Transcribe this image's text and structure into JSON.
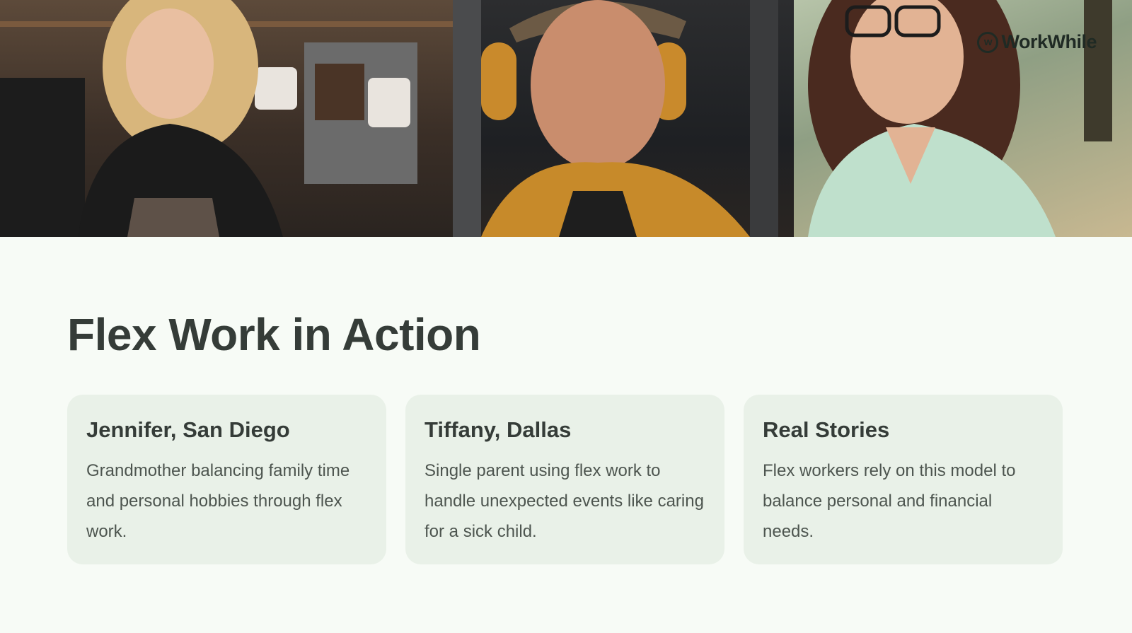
{
  "brand": {
    "name": "WorkWhile",
    "icon": "workwhile-logo-icon"
  },
  "photos": [
    {
      "icon": "barista-photo"
    },
    {
      "icon": "industrial-worker-photo"
    },
    {
      "icon": "office-worker-photo"
    }
  ],
  "title": "Flex Work in Action",
  "cards": [
    {
      "title": "Jennifer, San Diego",
      "text": "Grandmother balancing family time and personal hobbies through flex work."
    },
    {
      "title": "Tiffany, Dallas",
      "text": "Single parent using flex work to handle unexpected events like caring for a sick child."
    },
    {
      "title": "Real Stories",
      "text": "Flex workers rely on this model to balance personal and financial needs."
    }
  ],
  "colors": {
    "background": "#f7fbf6",
    "card": "#e9f1e8",
    "heading": "#353c38",
    "body_text": "#4d554f"
  }
}
